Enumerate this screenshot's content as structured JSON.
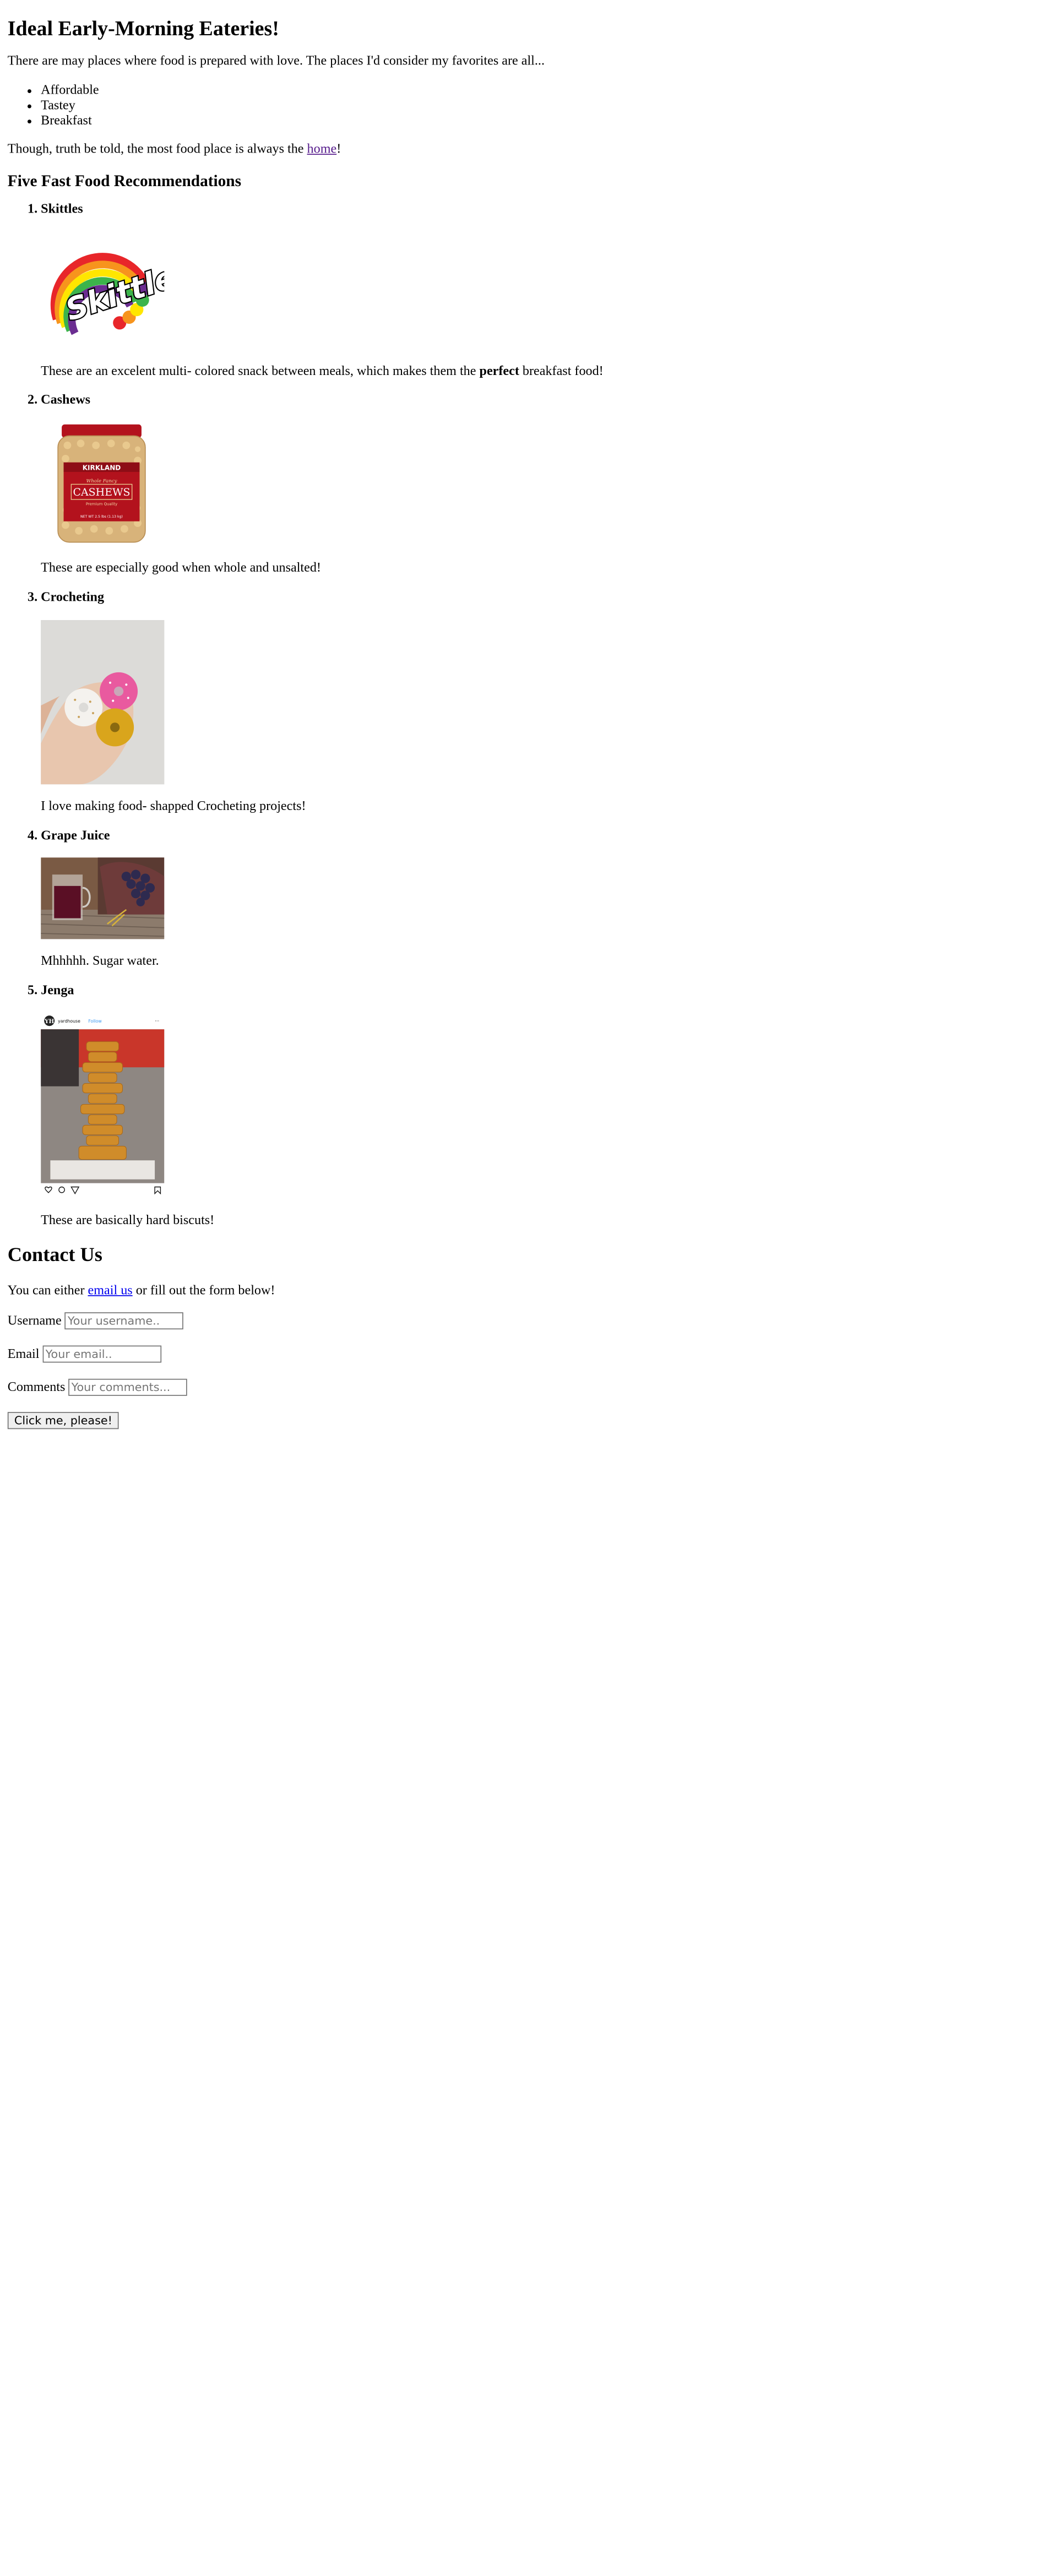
{
  "page": {
    "title": "Ideal Early-Morning Eateries!",
    "intro": "There are may places where food is prepared with love. The places I'd consider my favorites are all...",
    "traits": [
      "Affordable",
      "Tastey",
      "Breakfast"
    ],
    "truth_before": "Though, truth be told, the most food place is always the ",
    "truth_link": "home",
    "truth_after": "!",
    "recs_heading": "Five Fast Food Recommendations"
  },
  "recommendations": [
    {
      "title": "Skittles",
      "text_before": "These are an excelent multi- colored snack between meals, which makes them the ",
      "text_bold": "perfect",
      "text_after": " breakfast food!",
      "image_icon": "skittles-logo-image"
    },
    {
      "title": "Cashews",
      "text": "These are especially good when whole and unsalted!",
      "image_icon": "cashews-jar-image",
      "label_brand": "KIRKLAND",
      "label_sub": "Whole Fancy",
      "label_name": "CASHEWS",
      "label_quality": "Premium Quality",
      "label_net": "NET WT 2.5 lbs (1.13 kg)"
    },
    {
      "title": "Crocheting",
      "text": "I love making food- shapped Crocheting projects!",
      "image_icon": "crochet-donuts-image"
    },
    {
      "title": "Grape Juice",
      "text": "Mhhhhh. Sugar water.",
      "image_icon": "grape-juice-image"
    },
    {
      "title": "Jenga",
      "text": "These are basically hard biscuts!",
      "image_icon": "jenga-post-image",
      "post_user": "yardhouse",
      "post_follow": "Follow",
      "post_more": "···"
    }
  ],
  "contact": {
    "heading": "Contact Us",
    "text_before": "You can either ",
    "email_link": "email us",
    "text_after": " or fill out the form below!",
    "username_label": "Username",
    "username_placeholder": "Your username..",
    "email_label": "Email",
    "email_placeholder": "Your email..",
    "comments_label": "Comments",
    "comments_placeholder": "Your comments...",
    "submit_label": "Click me, please!"
  },
  "colors": {
    "link": "#0000ee",
    "visited_link": "#551a8b",
    "cashew_label": "#b3121d",
    "grape_juice": "#5a0f25",
    "skittles_red": "#e8262a"
  }
}
